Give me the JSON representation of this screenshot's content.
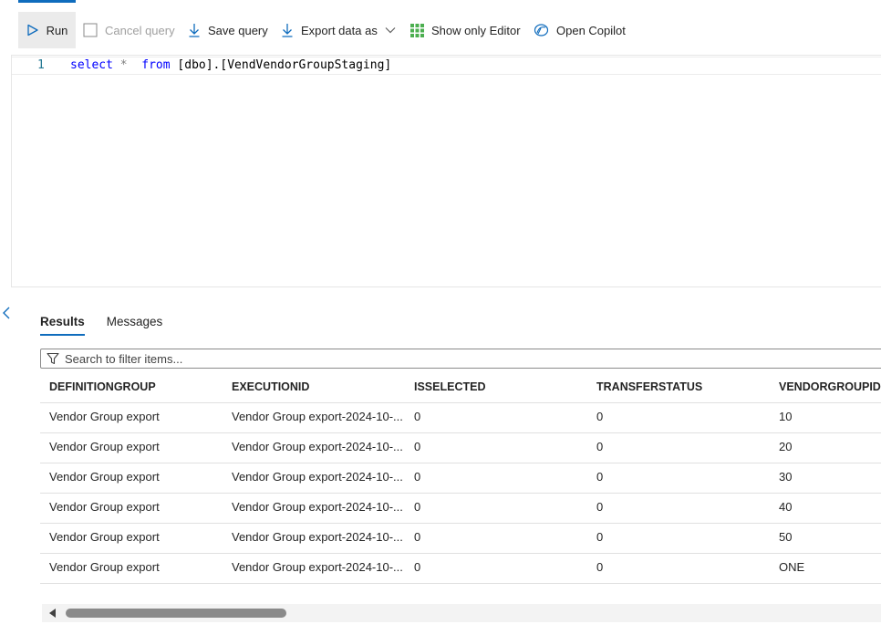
{
  "toolbar": {
    "run_label": "Run",
    "cancel_label": "Cancel query",
    "save_label": "Save query",
    "export_label": "Export data as",
    "show_editor_label": "Show only Editor",
    "copilot_label": "Open Copilot"
  },
  "editor": {
    "line_number": "1",
    "query": {
      "kw_select": "select",
      "star": "*",
      "kw_from": "from",
      "table": "[dbo].[VendVendorGroupStaging]"
    }
  },
  "results": {
    "tabs": [
      "Results",
      "Messages"
    ],
    "active_tab": "Results",
    "filter_placeholder": "Search to filter items...",
    "columns": [
      "DEFINITIONGROUP",
      "EXECUTIONID",
      "ISSELECTED",
      "TRANSFERSTATUS",
      "VENDORGROUPID"
    ],
    "rows": [
      [
        "Vendor Group export",
        "Vendor Group export-2024-10-...",
        "0",
        "0",
        "10"
      ],
      [
        "Vendor Group export",
        "Vendor Group export-2024-10-...",
        "0",
        "0",
        "20"
      ],
      [
        "Vendor Group export",
        "Vendor Group export-2024-10-...",
        "0",
        "0",
        "30"
      ],
      [
        "Vendor Group export",
        "Vendor Group export-2024-10-...",
        "0",
        "0",
        "40"
      ],
      [
        "Vendor Group export",
        "Vendor Group export-2024-10-...",
        "0",
        "0",
        "50"
      ],
      [
        "Vendor Group export",
        "Vendor Group export-2024-10-...",
        "0",
        "0",
        "ONE"
      ]
    ]
  },
  "colors": {
    "accent": "#0f6cbd",
    "grid_icon": "#4caf50",
    "line_number": "#237893",
    "keyword": "#0000ff"
  }
}
